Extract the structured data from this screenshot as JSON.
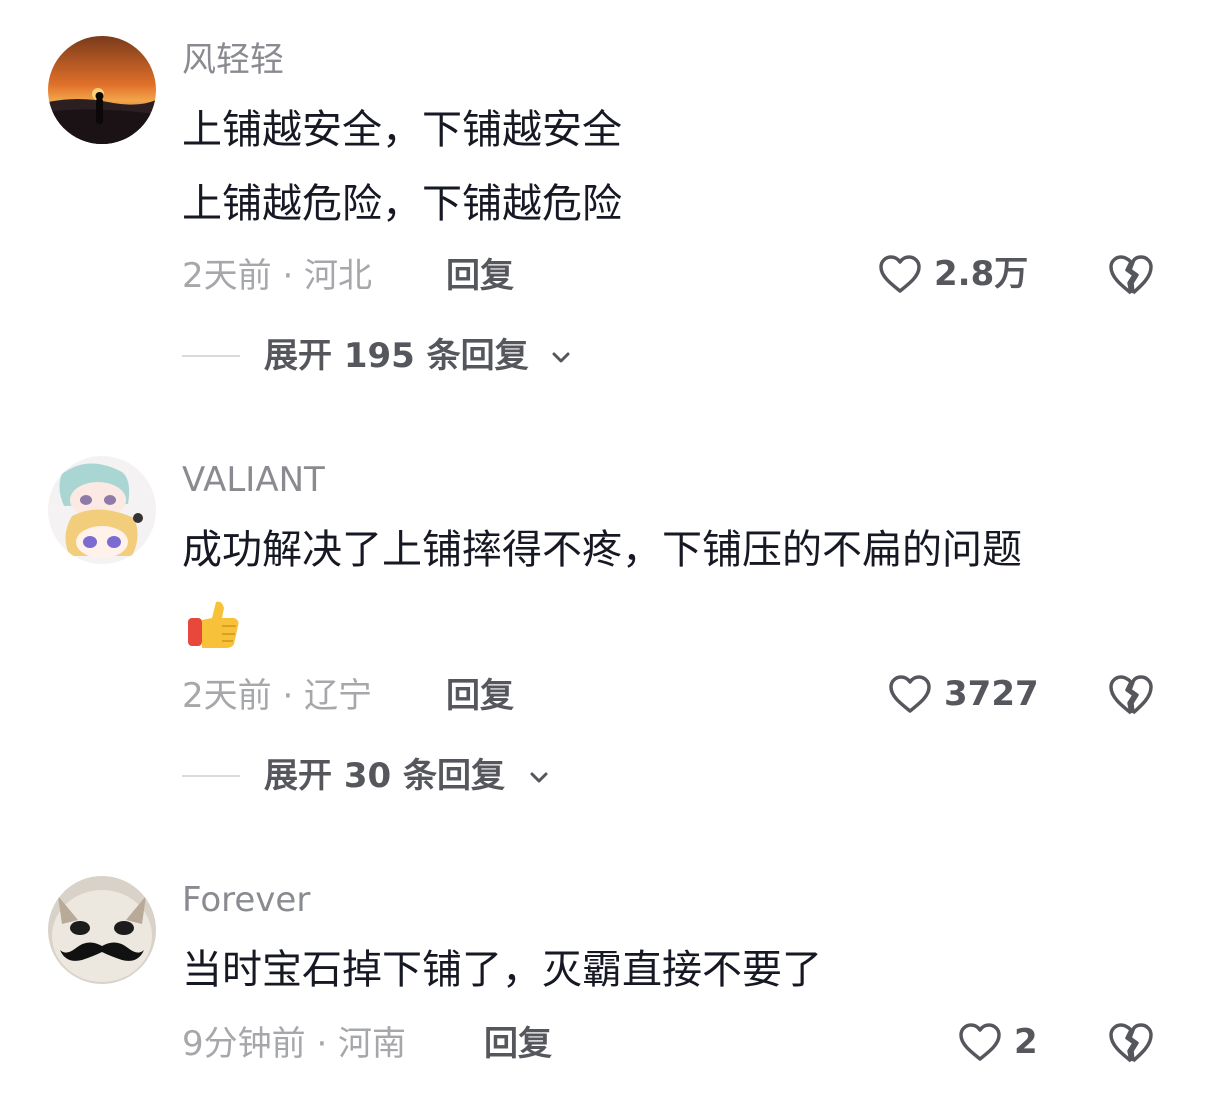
{
  "comments": [
    {
      "username": "风轻轻",
      "lines": [
        "上铺越安全，下铺越安全",
        "上铺越危险，下铺越危险"
      ],
      "time_location": "2天前 · 河北",
      "reply_label": "回复",
      "like_count": "2.8万",
      "expand_label": "展开 195 条回复"
    },
    {
      "username": "VALIANT",
      "lines": [
        "成功解决了上铺摔得不疼，下铺压的不扁的问题"
      ],
      "emoji": "thumbs-up-icon",
      "time_location": "2天前 · 辽宁",
      "reply_label": "回复",
      "like_count": "3727",
      "expand_label": "展开 30 条回复"
    },
    {
      "username": "Forever",
      "lines": [
        "当时宝石掉下铺了，灭霸直接不要了"
      ],
      "time_location": "9分钟前 · 河南",
      "reply_label": "回复",
      "like_count": "2"
    }
  ],
  "colors": {
    "primary_text": "#161823",
    "secondary_text": "#8a8b91",
    "meta_text": "#a6a7ab",
    "action_text": "#56575d",
    "background": "#ffffff"
  }
}
